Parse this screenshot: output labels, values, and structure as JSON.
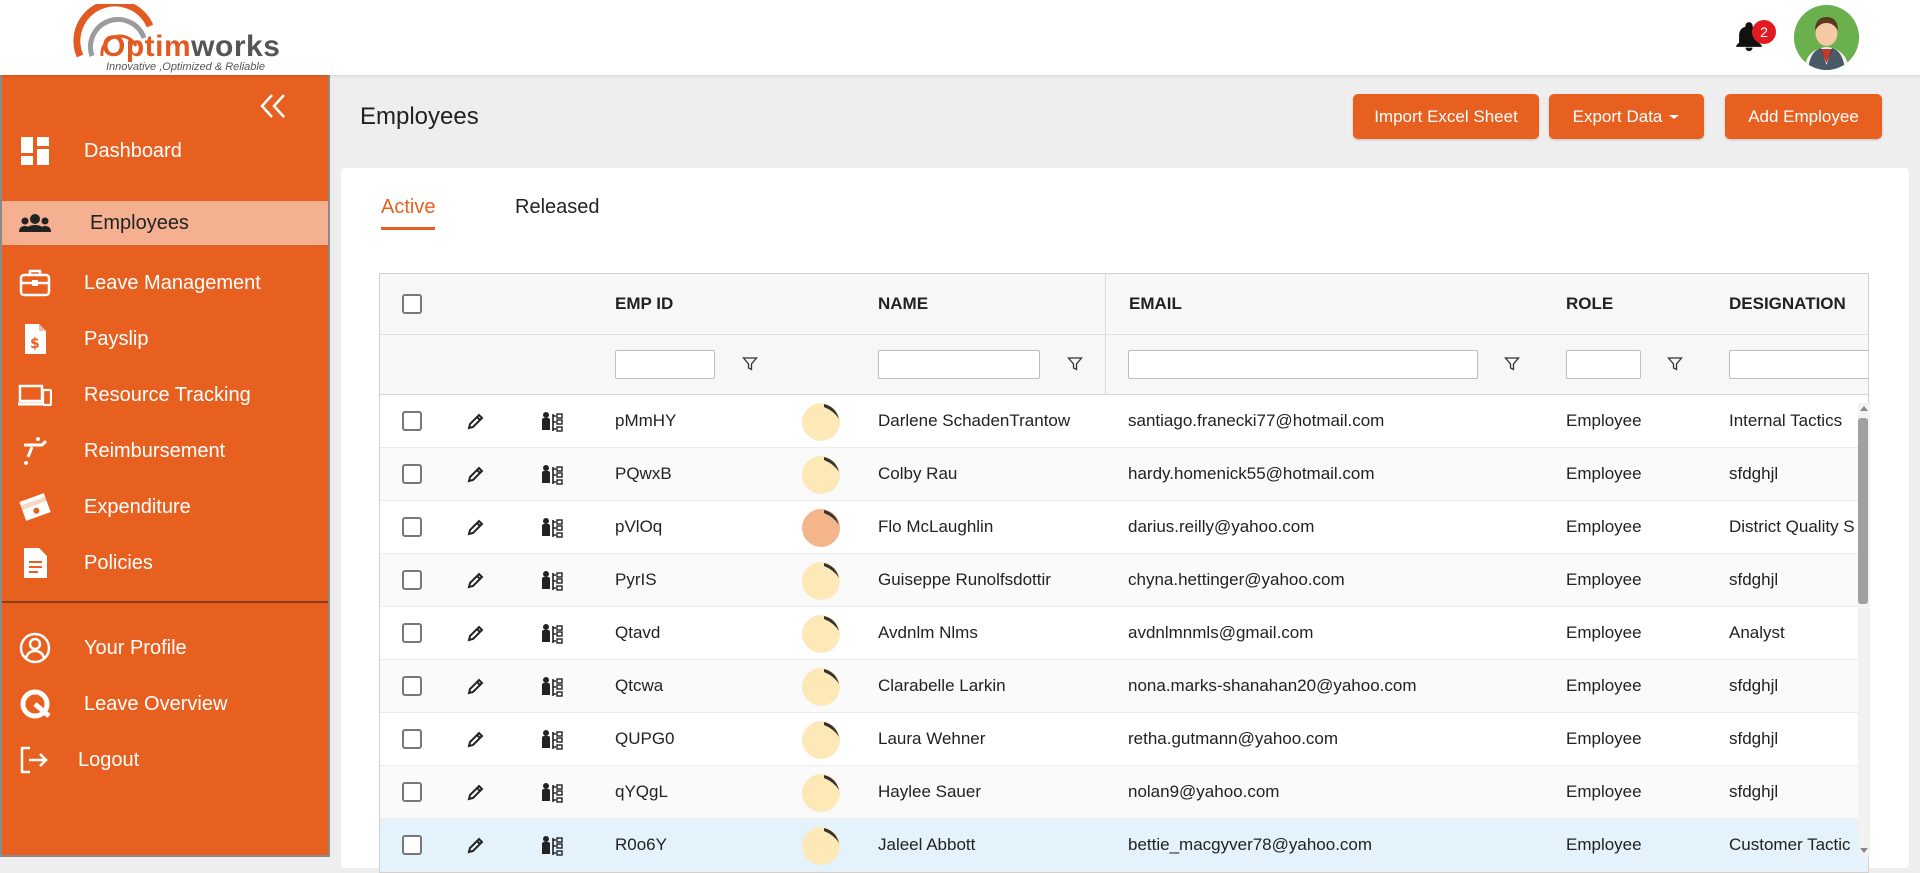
{
  "brand": {
    "name_o": "O",
    "name_ptim": "ptim",
    "name_works": "works",
    "tagline": "Innovative ,Optimized & Reliable",
    "accent": "#e8601f"
  },
  "header": {
    "notification_count": "2"
  },
  "sidebar": {
    "items": [
      {
        "label": "Dashboard",
        "icon": "dashboard-icon"
      },
      {
        "label": "Employees",
        "icon": "people-icon",
        "active": true
      },
      {
        "label": "Leave Management",
        "icon": "briefcase-icon"
      },
      {
        "label": "Payslip",
        "icon": "payslip-icon"
      },
      {
        "label": "Resource Tracking",
        "icon": "devices-icon"
      },
      {
        "label": "Reimbursement",
        "icon": "reimbursement-icon"
      },
      {
        "label": "Expenditure",
        "icon": "money-icon"
      },
      {
        "label": "Policies",
        "icon": "document-icon"
      }
    ],
    "bottom_items": [
      {
        "label": "Your Profile",
        "icon": "profile-icon"
      },
      {
        "label": "Leave Overview",
        "icon": "leave-overview-icon"
      },
      {
        "label": "Logout",
        "icon": "logout-icon"
      }
    ]
  },
  "page": {
    "title": "Employees",
    "buttons": {
      "import": "Import Excel Sheet",
      "export": "Export Data",
      "add": "Add Employee"
    },
    "tabs": [
      {
        "label": "Active",
        "active": true
      },
      {
        "label": "Released"
      }
    ]
  },
  "table": {
    "columns": {
      "emp_id": "EMP ID",
      "name": "NAME",
      "email": "EMAIL",
      "role": "ROLE",
      "designation": "DESIGNATION"
    },
    "rows": [
      {
        "emp_id": "pMmHY",
        "name": "Darlene SchadenTrantow",
        "email": "santiago.franecki77@hotmail.com",
        "role": "Employee",
        "designation": "Internal Tactics"
      },
      {
        "emp_id": "PQwxB",
        "name": "Colby Rau",
        "email": "hardy.homenick55@hotmail.com",
        "role": "Employee",
        "designation": "sfdghjl"
      },
      {
        "emp_id": "pVlOq",
        "name": "Flo McLaughlin",
        "email": "darius.reilly@yahoo.com",
        "role": "Employee",
        "designation": "District Quality S"
      },
      {
        "emp_id": "PyrIS",
        "name": "Guiseppe Runolfsdottir",
        "email": "chyna.hettinger@yahoo.com",
        "role": "Employee",
        "designation": "sfdghjl"
      },
      {
        "emp_id": "Qtavd",
        "name": "Avdnlm Nlms",
        "email": "avdnlmnmls@gmail.com",
        "role": "Employee",
        "designation": "Analyst"
      },
      {
        "emp_id": "Qtcwa",
        "name": "Clarabelle Larkin",
        "email": "nona.marks-shanahan20@yahoo.com",
        "role": "Employee",
        "designation": "sfdghjl"
      },
      {
        "emp_id": "QUPG0",
        "name": "Laura Wehner",
        "email": "retha.gutmann@yahoo.com",
        "role": "Employee",
        "designation": "sfdghjl"
      },
      {
        "emp_id": "qYQgL",
        "name": "Haylee Sauer",
        "email": "nolan9@yahoo.com",
        "role": "Employee",
        "designation": "sfdghjl"
      },
      {
        "emp_id": "R0o6Y",
        "name": "Jaleel Abbott",
        "email": "bettie_macgyver78@yahoo.com",
        "role": "Employee",
        "designation": "Customer Tactic"
      }
    ]
  }
}
